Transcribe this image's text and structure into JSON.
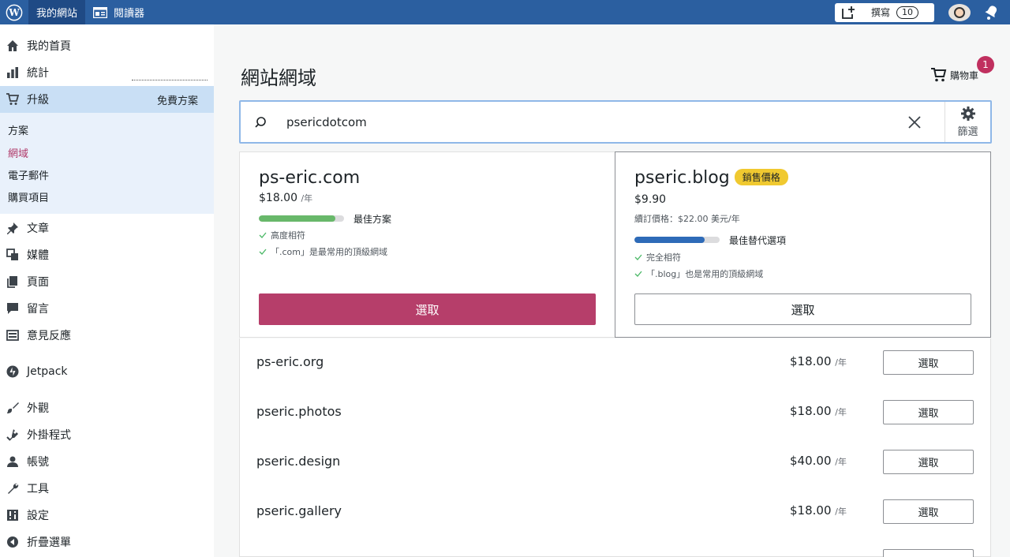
{
  "masterbar": {
    "my_site": "我的網站",
    "reader": "閱讀器",
    "write_label": "撰寫",
    "write_count": "10"
  },
  "sidebar": {
    "items": [
      {
        "label": "我的首頁",
        "icon": "home-icon"
      },
      {
        "label": "統計",
        "icon": "stats-icon"
      },
      {
        "label": "升級",
        "icon": "cart-icon",
        "badge": "免費方案"
      },
      {
        "label": "文章",
        "icon": "pin-icon"
      },
      {
        "label": "媒體",
        "icon": "media-icon"
      },
      {
        "label": "頁面",
        "icon": "pages-icon"
      },
      {
        "label": "留言",
        "icon": "comment-icon"
      },
      {
        "label": "意見反應",
        "icon": "feedback-icon"
      },
      {
        "label": "Jetpack",
        "icon": "jetpack-icon"
      },
      {
        "label": "外觀",
        "icon": "brush-icon"
      },
      {
        "label": "外掛程式",
        "icon": "plugin-icon"
      },
      {
        "label": "帳號",
        "icon": "user-icon"
      },
      {
        "label": "工具",
        "icon": "wrench-icon"
      },
      {
        "label": "設定",
        "icon": "settings-icon"
      },
      {
        "label": "折疊選單",
        "icon": "collapse-icon"
      }
    ],
    "sub": [
      "方案",
      "網域",
      "電子郵件",
      "購買項目"
    ]
  },
  "page": {
    "title": "網站網域",
    "cart_label": "購物車",
    "cart_count": "1"
  },
  "search": {
    "query": "psericdotcom",
    "filter_label": "篩選"
  },
  "featured": [
    {
      "domain": "ps-eric.com",
      "price": "$18.00",
      "per": "/年",
      "match_label": "最佳方案",
      "match_fraction": 0.9,
      "checks": [
        "高度相符",
        "「.com」是最常用的頂級網域"
      ],
      "select": "選取"
    },
    {
      "domain": "pseric.blog",
      "sale": "銷售價格",
      "price": "$9.90",
      "renew": "續訂價格：$22.00 美元/年",
      "match_label": "最佳替代選項",
      "match_fraction": 0.82,
      "checks": [
        "完全相符",
        "「.blog」也是常用的頂級網域"
      ],
      "select": "選取"
    }
  ],
  "results": [
    {
      "domain": "ps-eric.org",
      "price": "$18.00",
      "per": "/年",
      "select": "選取"
    },
    {
      "domain": "pseric.photos",
      "price": "$18.00",
      "per": "/年",
      "select": "選取"
    },
    {
      "domain": "pseric.design",
      "price": "$40.00",
      "per": "/年",
      "select": "選取"
    },
    {
      "domain": "pseric.gallery",
      "price": "$18.00",
      "per": "/年",
      "select": "選取"
    }
  ],
  "colors": {
    "masterbar": "#2b5fa0",
    "primary_button": "#b63e6a",
    "bar_green": "#68b86a",
    "bar_blue": "#2e6bb8",
    "sale_badge": "#f0c930"
  }
}
